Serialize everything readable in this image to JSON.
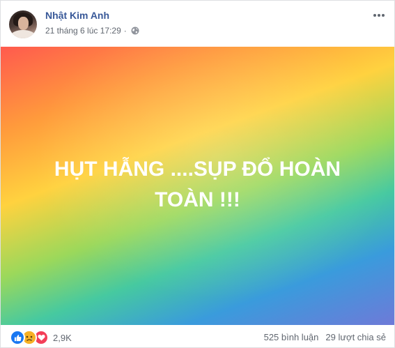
{
  "post": {
    "author": "Nhật Kim Anh",
    "timestamp": "21 tháng 6 lúc 17:29",
    "dot": "·",
    "privacy_icon": "globe-icon",
    "more_icon": "more-options-icon",
    "image_text_line1": "HỤT HẪNG ....SỤP ĐỔ HOÀN",
    "image_text_line2": "TOÀN !!!",
    "background_colors": [
      "#ff5a4e",
      "#ff9a3c",
      "#ffd23f",
      "#9bd85b",
      "#46c9a0",
      "#3a9bdc",
      "#6e7ad8"
    ]
  },
  "footer": {
    "reactions": [
      "like-icon",
      "sad-icon",
      "love-icon"
    ],
    "reaction_count": "2,9K",
    "comments": "525 bình luận",
    "shares": "29 lượt chia sẻ"
  },
  "colors": {
    "author_link": "#385898",
    "meta_text": "#616770",
    "like": "#1877f2",
    "sad": "#f7b125",
    "love": "#f33e58"
  }
}
